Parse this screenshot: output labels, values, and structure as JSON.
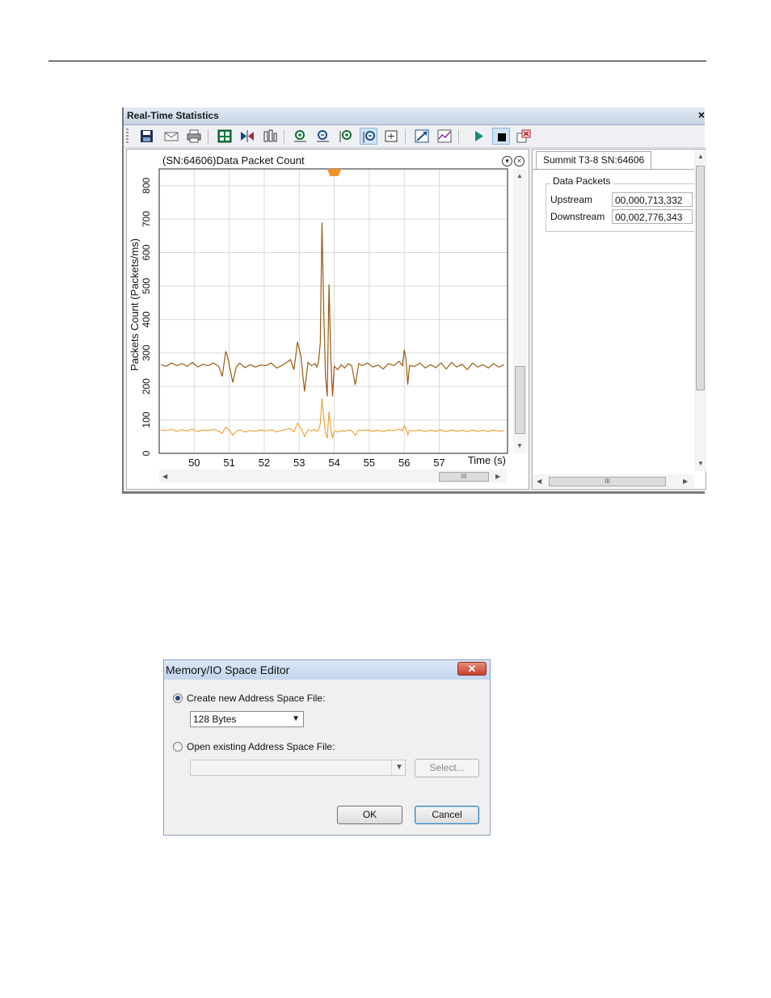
{
  "rts": {
    "title": "Real-Time Statistics",
    "close_glyph": "×",
    "toolbar_icons": [
      "save-icon",
      "envelope-icon",
      "print-icon",
      "layout-icon",
      "flip-icon",
      "columns-icon",
      "zoom-in-horizontal-icon",
      "zoom-out-horizontal-icon",
      "zoom-in-vertical-icon",
      "zoom-out-vertical-icon",
      "zoom-fit-icon",
      "expand-icon",
      "chart-edit-icon",
      "play-icon",
      "stop-icon",
      "clear-icon"
    ],
    "chart_title": "(SN:64606)Data Packet Count",
    "side_tab": "Summit T3-8 SN:64606",
    "group_label": "Data Packets",
    "upstream_label": "Upstream",
    "upstream_value": "00,000,713,332",
    "downstream_label": "Downstream",
    "downstream_value": "00,002,776,343",
    "scroll_grip": "III"
  },
  "chart_data": {
    "type": "line",
    "title": "(SN:64606)Data Packet Count",
    "xlabel": "Time (s)",
    "ylabel": "Packets Count (Packets/ms)",
    "xlim": [
      49.0,
      58.95
    ],
    "ylim": [
      0,
      850
    ],
    "xticks": [
      50,
      51,
      52,
      53,
      54,
      55,
      56,
      57
    ],
    "yticks": [
      0,
      100,
      200,
      300,
      400,
      500,
      600,
      700,
      800
    ],
    "grid": true,
    "colors": [
      "#9c5a10",
      "#f3a43c"
    ],
    "series": [
      {
        "x": [
          49.05,
          49.2,
          49.35,
          49.5,
          49.65,
          49.8,
          49.95,
          50.1,
          50.25,
          50.4,
          50.55,
          50.7,
          50.8,
          50.9,
          50.95,
          51.0,
          51.1,
          51.2,
          51.3,
          51.45,
          51.6,
          51.75,
          51.9,
          52.05,
          52.2,
          52.35,
          52.5,
          52.65,
          52.75,
          52.85,
          52.95,
          53.05,
          53.15,
          53.25,
          53.35,
          53.45,
          53.5,
          53.55,
          53.6,
          53.65,
          53.7,
          53.75,
          53.8,
          53.85,
          53.9,
          53.95,
          54.0,
          54.05,
          54.1,
          54.2,
          54.3,
          54.4,
          54.5,
          54.6,
          54.7,
          54.8,
          54.95,
          55.1,
          55.25,
          55.4,
          55.55,
          55.7,
          55.85,
          55.95,
          56.0,
          56.05,
          56.1,
          56.15,
          56.3,
          56.45,
          56.6,
          56.75,
          56.9,
          57.05,
          57.2,
          57.35,
          57.5,
          57.65,
          57.8,
          57.95,
          58.1,
          58.25,
          58.4,
          58.55,
          58.7,
          58.85
        ],
        "values": [
          265,
          260,
          270,
          262,
          268,
          260,
          272,
          258,
          266,
          262,
          270,
          260,
          230,
          305,
          290,
          265,
          212,
          258,
          270,
          256,
          265,
          258,
          264,
          262,
          270,
          255,
          262,
          272,
          280,
          250,
          333,
          290,
          185,
          272,
          262,
          268,
          258,
          272,
          330,
          690,
          420,
          230,
          170,
          505,
          290,
          170,
          260,
          255,
          250,
          265,
          255,
          268,
          262,
          205,
          268,
          262,
          270,
          258,
          264,
          252,
          268,
          262,
          275,
          262,
          310,
          280,
          205,
          262,
          260,
          270,
          255,
          265,
          256,
          270,
          252,
          272,
          258,
          266,
          250,
          270,
          258,
          265,
          255,
          268,
          258,
          265
        ]
      },
      {
        "x": [
          49.05,
          49.2,
          49.35,
          49.5,
          49.65,
          49.8,
          49.95,
          50.1,
          50.25,
          50.4,
          50.55,
          50.7,
          50.8,
          50.9,
          50.95,
          51.0,
          51.1,
          51.2,
          51.3,
          51.45,
          51.6,
          51.75,
          51.9,
          52.05,
          52.2,
          52.35,
          52.5,
          52.65,
          52.75,
          52.85,
          52.95,
          53.05,
          53.15,
          53.25,
          53.35,
          53.45,
          53.5,
          53.55,
          53.6,
          53.65,
          53.7,
          53.75,
          53.8,
          53.85,
          53.9,
          53.95,
          54.0,
          54.05,
          54.1,
          54.2,
          54.3,
          54.4,
          54.5,
          54.6,
          54.7,
          54.8,
          54.95,
          55.1,
          55.25,
          55.4,
          55.55,
          55.7,
          55.85,
          55.95,
          56.0,
          56.05,
          56.1,
          56.15,
          56.3,
          56.45,
          56.6,
          56.75,
          56.9,
          57.05,
          57.2,
          57.35,
          57.5,
          57.65,
          57.8,
          57.95,
          58.1,
          58.25,
          58.4,
          58.55,
          58.7,
          58.85
        ],
        "values": [
          70,
          68,
          72,
          66,
          71,
          67,
          73,
          65,
          70,
          68,
          72,
          66,
          60,
          78,
          75,
          70,
          54,
          66,
          70,
          64,
          68,
          66,
          70,
          67,
          71,
          64,
          68,
          72,
          74,
          64,
          90,
          75,
          50,
          70,
          67,
          71,
          66,
          70,
          88,
          165,
          105,
          60,
          45,
          125,
          75,
          45,
          67,
          66,
          64,
          68,
          66,
          70,
          68,
          54,
          70,
          68,
          70,
          66,
          69,
          65,
          70,
          68,
          72,
          68,
          82,
          74,
          55,
          68,
          67,
          70,
          65,
          69,
          66,
          70,
          65,
          70,
          66,
          69,
          65,
          70,
          66,
          69,
          65,
          70,
          66,
          68
        ]
      }
    ]
  },
  "dialog": {
    "title": "Memory/IO Space Editor",
    "close_glyph": "✕",
    "create_label": "Create new Address Space File:",
    "size_value": "128 Bytes",
    "open_label": "Open existing Address Space File:",
    "open_value": "",
    "select_button": "Select...",
    "ok_button": "OK",
    "cancel_button": "Cancel",
    "dropdown_glyph": "▼"
  }
}
